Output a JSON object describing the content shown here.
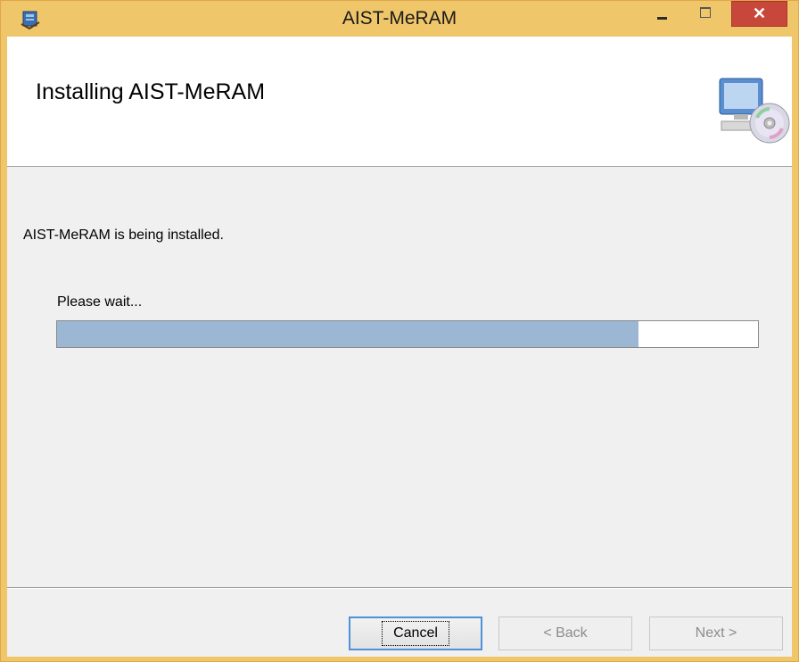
{
  "window": {
    "title": "AIST-MeRAM",
    "close_glyph": "✕"
  },
  "header": {
    "title": "Installing AIST-MeRAM",
    "art_icon": "computer-with-disc-icon"
  },
  "main": {
    "status_text": "AIST-MeRAM is being installed.",
    "wait_label": "Please wait...",
    "progress_fraction": 0.83
  },
  "buttons": {
    "cancel": "Cancel",
    "back": "< Back",
    "next": "Next >"
  },
  "colors": {
    "titlebar": "#f0c66b",
    "close_button": "#c7483a",
    "progress_fill": "#9bb7d4",
    "focus_border": "#4f91d8"
  }
}
